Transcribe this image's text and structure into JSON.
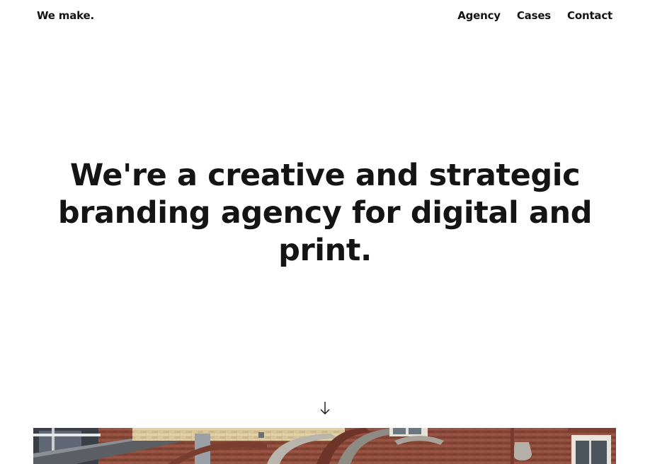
{
  "header": {
    "logo": "We make.",
    "nav": [
      {
        "label": "Agency"
      },
      {
        "label": "Cases"
      },
      {
        "label": "Contact"
      }
    ]
  },
  "hero": {
    "headline": "We're a creative and strategic branding agency for digital and print."
  },
  "scroll": {
    "icon": "arrow-down-icon"
  },
  "photo": {
    "subject": "brick building facade"
  }
}
